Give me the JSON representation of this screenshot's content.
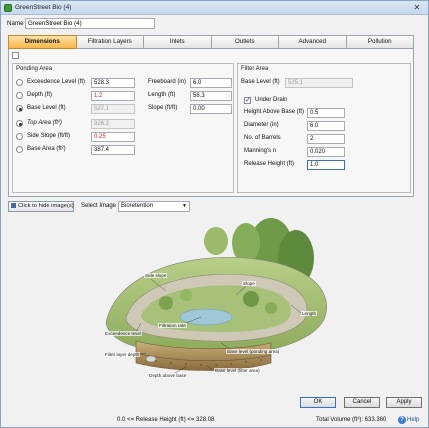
{
  "window": {
    "title": "GreenStreet Bio (4)",
    "close_glyph": "✕"
  },
  "name": {
    "label": "Name",
    "value": "GreenStreet Bio (4)"
  },
  "tabs": [
    {
      "label": "Dimensions",
      "active": true
    },
    {
      "label": "Filtration Layers",
      "active": false
    },
    {
      "label": "Inlets",
      "active": false
    },
    {
      "label": "Outlets",
      "active": false
    },
    {
      "label": "Advanced",
      "active": false
    },
    {
      "label": "Pollution",
      "active": false
    }
  ],
  "ponding": {
    "title": "Ponding Area",
    "rows": [
      {
        "label": "Exceedence Level (ft)",
        "value": "528.3",
        "selected": false,
        "style": "normal"
      },
      {
        "label": "Depth (ft)",
        "value": "1.2",
        "selected": false,
        "style": "red"
      },
      {
        "label": "Base Level (ft)",
        "value": "527.1",
        "selected": true,
        "style": "disabled"
      },
      {
        "label": "Top Area (ft²)",
        "value": "926.2",
        "selected": true,
        "style": "disabled",
        "italic": true
      },
      {
        "label": "Side Slope (ft/ft)",
        "value": "0.25",
        "selected": false,
        "style": "red"
      },
      {
        "label": "Base Area (ft²)",
        "value": "387.4",
        "selected": false,
        "style": "normal"
      }
    ],
    "extra": [
      {
        "label": "Freeboard (in)",
        "value": "6.0"
      },
      {
        "label": "Length (ft)",
        "value": "56.3"
      },
      {
        "label": "Slope (ft/ft)",
        "value": "0.00"
      }
    ]
  },
  "filter": {
    "title": "Filter Area",
    "base_level": {
      "label": "Base Level (ft)",
      "value": "525.1"
    },
    "under_drain": {
      "label": "Under Drain",
      "checked": true
    },
    "rows": [
      {
        "label": "Height Above Base (ft)",
        "value": "0.5"
      },
      {
        "label": "Diameter (in)",
        "value": "6.0"
      },
      {
        "label": "No. of Barrels",
        "value": "2"
      },
      {
        "label": "Manning's n",
        "value": "0.020"
      },
      {
        "label": "Release Height (ft)",
        "value": "1.0"
      }
    ]
  },
  "image_controls": {
    "hide_button": "Click to hide image(s)",
    "select_label": "Select Image",
    "selected_image": "Bioretention"
  },
  "figure_labels": {
    "side_slope": "Side slope",
    "slope": "Slope",
    "length": "Length",
    "filtration_rate": "Filtration rate",
    "exceedence_level": "Exceedence level",
    "filter_layer_depth": "Filter layer depth",
    "base_level_ponding": "Base level (ponding area)",
    "depth_above_base": "Depth above base",
    "base_level_filter": "Base level (filter area)"
  },
  "buttons": {
    "ok": "OK",
    "cancel": "Cancel",
    "apply": "Apply"
  },
  "status": {
    "constraint": "0.0 <= Release Height (ft) <= 328.08",
    "total_volume": "Total Volume (ft³): 633.360",
    "help": "Help",
    "help_glyph": "?"
  }
}
